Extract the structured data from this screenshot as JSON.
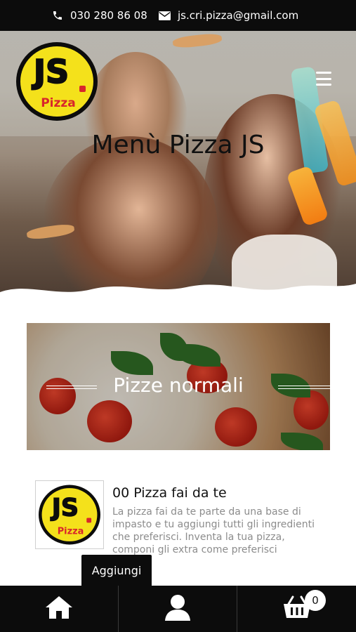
{
  "contact": {
    "phone": "030 280 86 08",
    "email": "js.cri.pizza@gmail.com"
  },
  "brand": {
    "logo_text": "JS",
    "logo_subtext": "Pizza",
    "colors": {
      "yellow": "#f4e11b",
      "black": "#0c0c0c",
      "red": "#d8262b"
    }
  },
  "hero": {
    "title": "Menù Pizza JS",
    "menu_icon": "hamburger-icon"
  },
  "category": {
    "title": "Pizze normali"
  },
  "product": {
    "name": "00 Pizza fai da te",
    "description": "La pizza fai da te parte da una base di impasto e tu aggiungi tutti gli ingredienti che preferisci. Inventa la tua pizza, componi gli extra come preferisci",
    "add_label": "Aggiungi"
  },
  "bottom_nav": {
    "items": [
      {
        "icon": "home-icon"
      },
      {
        "icon": "user-icon"
      },
      {
        "icon": "cart-icon"
      }
    ],
    "cart_count": "0"
  }
}
